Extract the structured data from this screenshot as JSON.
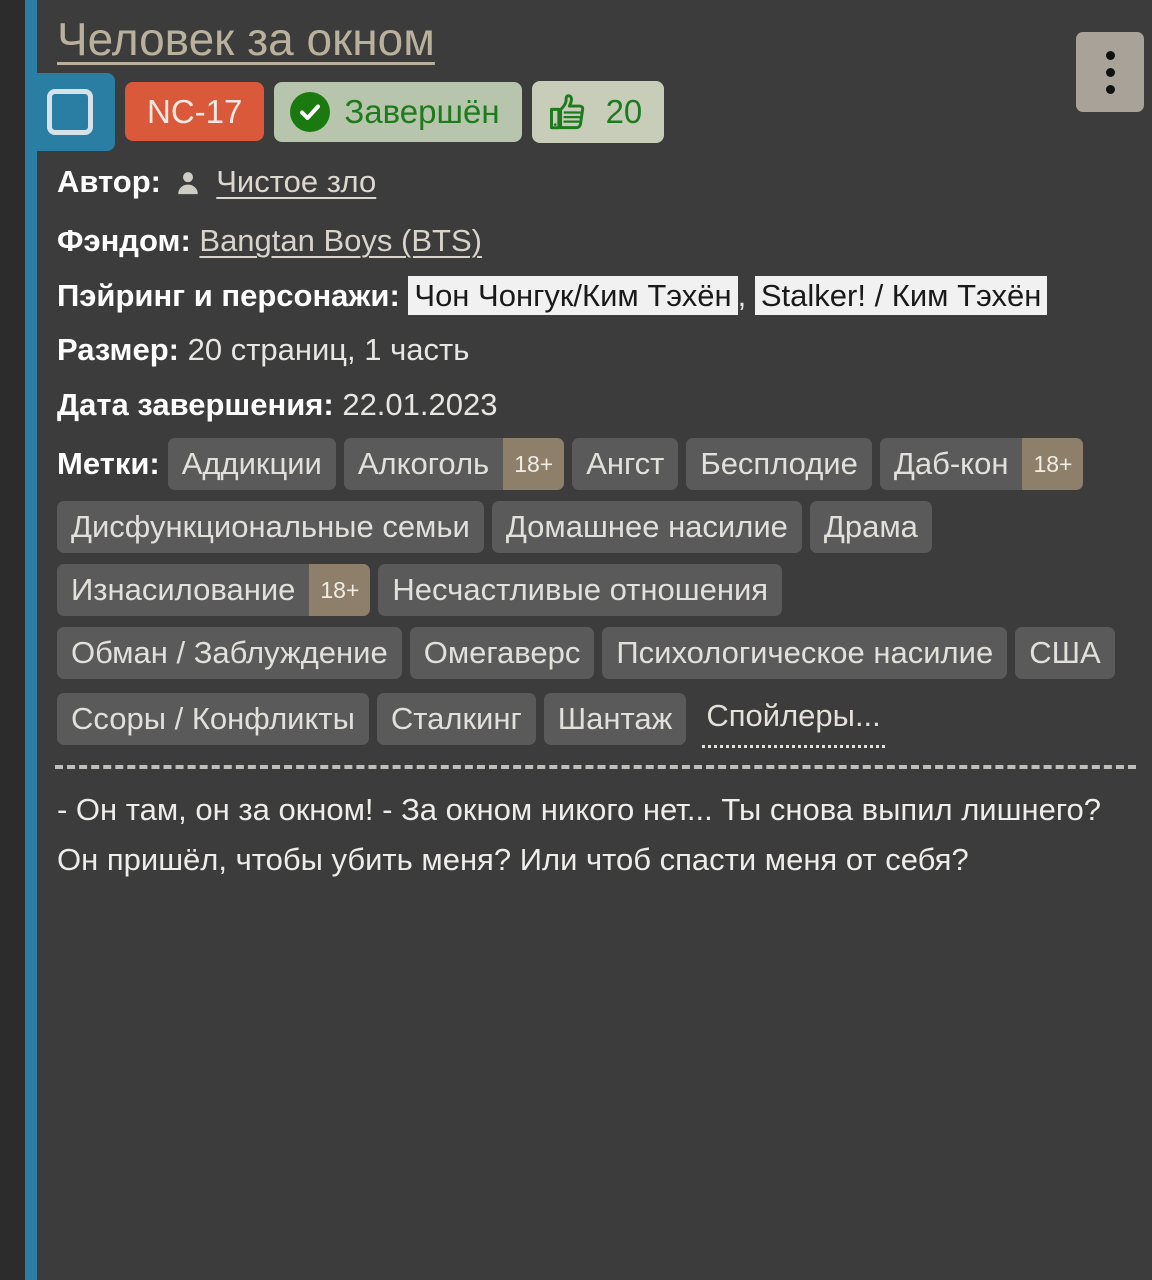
{
  "story": {
    "title": "Человек за окном",
    "menu_button": "more-options",
    "checkbox_checked": false
  },
  "badges": {
    "rating": "NC-17",
    "status_label": "Завершён",
    "likes_count": "20"
  },
  "meta": {
    "author_label": "Автор:",
    "author_name": "Чистое зло",
    "fandom_label": "Фэндом:",
    "fandom_name": "Bangtan Boys (BTS)",
    "pairing_label": "Пэйринг и персонажи:",
    "pairing_1": "Чон Чонгук/Ким Тэхён",
    "pairing_sep": ",",
    "pairing_2": "Stalker! / Ким Тэхён",
    "size_label": "Размер:",
    "size_value": "20 страниц, 1 часть",
    "date_label": "Дата завершения:",
    "date_value": "22.01.2023"
  },
  "tags": {
    "label": "Метки:",
    "items": [
      {
        "text": "Аддикции",
        "adult": ""
      },
      {
        "text": "Алкоголь",
        "adult": "18+"
      },
      {
        "text": "Ангст",
        "adult": ""
      },
      {
        "text": "Бесплодие",
        "adult": ""
      },
      {
        "text": "Даб-кон",
        "adult": "18+"
      },
      {
        "text": "Дисфункциональные семьи",
        "adult": ""
      },
      {
        "text": "Домашнее насилие",
        "adult": ""
      },
      {
        "text": "Драма",
        "adult": ""
      },
      {
        "text": "Изнасилование",
        "adult": "18+"
      },
      {
        "text": "Несчастливые отношения",
        "adult": ""
      },
      {
        "text": "Обман / Заблуждение",
        "adult": ""
      },
      {
        "text": "Омегаверс",
        "adult": ""
      },
      {
        "text": "Психологическое насилие",
        "adult": ""
      },
      {
        "text": "США",
        "adult": ""
      },
      {
        "text": "Ссоры / Конфликты",
        "adult": ""
      },
      {
        "text": "Сталкинг",
        "adult": ""
      },
      {
        "text": "Шантаж",
        "adult": ""
      }
    ],
    "spoiler": "Спойлеры..."
  },
  "description": "- Он там, он за окном! - За окном никого нет... Ты снова выпил лишнего? Он пришёл, чтобы убить меня? Или чтоб спасти меня от себя?",
  "colors": {
    "accent_rail": "#2a7ea3",
    "card_bg": "#3c3c3c",
    "page_bg": "#2c2c2c",
    "rating_bg": "#d9593a",
    "status_bg": "#b8c5ad",
    "status_fg": "#1d7a1d",
    "likes_bg": "#c8cdba",
    "title_fg": "#b9b19c",
    "tag_bg": "#5a5a5a",
    "adult_bg": "#8d7f69",
    "menu_bg": "#a9a299"
  }
}
